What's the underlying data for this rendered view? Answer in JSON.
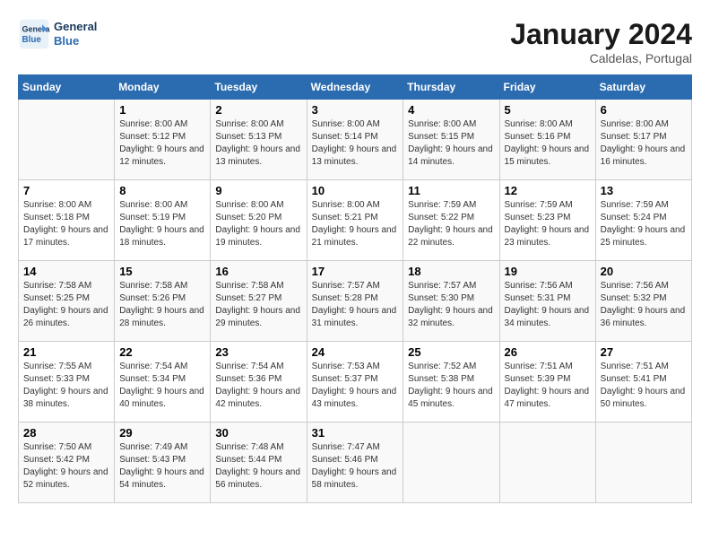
{
  "header": {
    "logo_line1": "General",
    "logo_line2": "Blue",
    "title": "January 2024",
    "subtitle": "Caldelas, Portugal"
  },
  "columns": [
    "Sunday",
    "Monday",
    "Tuesday",
    "Wednesday",
    "Thursday",
    "Friday",
    "Saturday"
  ],
  "weeks": [
    [
      {
        "day": "",
        "sunrise": "",
        "sunset": "",
        "daylight": ""
      },
      {
        "day": "1",
        "sunrise": "Sunrise: 8:00 AM",
        "sunset": "Sunset: 5:12 PM",
        "daylight": "Daylight: 9 hours and 12 minutes."
      },
      {
        "day": "2",
        "sunrise": "Sunrise: 8:00 AM",
        "sunset": "Sunset: 5:13 PM",
        "daylight": "Daylight: 9 hours and 13 minutes."
      },
      {
        "day": "3",
        "sunrise": "Sunrise: 8:00 AM",
        "sunset": "Sunset: 5:14 PM",
        "daylight": "Daylight: 9 hours and 13 minutes."
      },
      {
        "day": "4",
        "sunrise": "Sunrise: 8:00 AM",
        "sunset": "Sunset: 5:15 PM",
        "daylight": "Daylight: 9 hours and 14 minutes."
      },
      {
        "day": "5",
        "sunrise": "Sunrise: 8:00 AM",
        "sunset": "Sunset: 5:16 PM",
        "daylight": "Daylight: 9 hours and 15 minutes."
      },
      {
        "day": "6",
        "sunrise": "Sunrise: 8:00 AM",
        "sunset": "Sunset: 5:17 PM",
        "daylight": "Daylight: 9 hours and 16 minutes."
      }
    ],
    [
      {
        "day": "7",
        "sunrise": "Sunrise: 8:00 AM",
        "sunset": "Sunset: 5:18 PM",
        "daylight": "Daylight: 9 hours and 17 minutes."
      },
      {
        "day": "8",
        "sunrise": "Sunrise: 8:00 AM",
        "sunset": "Sunset: 5:19 PM",
        "daylight": "Daylight: 9 hours and 18 minutes."
      },
      {
        "day": "9",
        "sunrise": "Sunrise: 8:00 AM",
        "sunset": "Sunset: 5:20 PM",
        "daylight": "Daylight: 9 hours and 19 minutes."
      },
      {
        "day": "10",
        "sunrise": "Sunrise: 8:00 AM",
        "sunset": "Sunset: 5:21 PM",
        "daylight": "Daylight: 9 hours and 21 minutes."
      },
      {
        "day": "11",
        "sunrise": "Sunrise: 7:59 AM",
        "sunset": "Sunset: 5:22 PM",
        "daylight": "Daylight: 9 hours and 22 minutes."
      },
      {
        "day": "12",
        "sunrise": "Sunrise: 7:59 AM",
        "sunset": "Sunset: 5:23 PM",
        "daylight": "Daylight: 9 hours and 23 minutes."
      },
      {
        "day": "13",
        "sunrise": "Sunrise: 7:59 AM",
        "sunset": "Sunset: 5:24 PM",
        "daylight": "Daylight: 9 hours and 25 minutes."
      }
    ],
    [
      {
        "day": "14",
        "sunrise": "Sunrise: 7:58 AM",
        "sunset": "Sunset: 5:25 PM",
        "daylight": "Daylight: 9 hours and 26 minutes."
      },
      {
        "day": "15",
        "sunrise": "Sunrise: 7:58 AM",
        "sunset": "Sunset: 5:26 PM",
        "daylight": "Daylight: 9 hours and 28 minutes."
      },
      {
        "day": "16",
        "sunrise": "Sunrise: 7:58 AM",
        "sunset": "Sunset: 5:27 PM",
        "daylight": "Daylight: 9 hours and 29 minutes."
      },
      {
        "day": "17",
        "sunrise": "Sunrise: 7:57 AM",
        "sunset": "Sunset: 5:28 PM",
        "daylight": "Daylight: 9 hours and 31 minutes."
      },
      {
        "day": "18",
        "sunrise": "Sunrise: 7:57 AM",
        "sunset": "Sunset: 5:30 PM",
        "daylight": "Daylight: 9 hours and 32 minutes."
      },
      {
        "day": "19",
        "sunrise": "Sunrise: 7:56 AM",
        "sunset": "Sunset: 5:31 PM",
        "daylight": "Daylight: 9 hours and 34 minutes."
      },
      {
        "day": "20",
        "sunrise": "Sunrise: 7:56 AM",
        "sunset": "Sunset: 5:32 PM",
        "daylight": "Daylight: 9 hours and 36 minutes."
      }
    ],
    [
      {
        "day": "21",
        "sunrise": "Sunrise: 7:55 AM",
        "sunset": "Sunset: 5:33 PM",
        "daylight": "Daylight: 9 hours and 38 minutes."
      },
      {
        "day": "22",
        "sunrise": "Sunrise: 7:54 AM",
        "sunset": "Sunset: 5:34 PM",
        "daylight": "Daylight: 9 hours and 40 minutes."
      },
      {
        "day": "23",
        "sunrise": "Sunrise: 7:54 AM",
        "sunset": "Sunset: 5:36 PM",
        "daylight": "Daylight: 9 hours and 42 minutes."
      },
      {
        "day": "24",
        "sunrise": "Sunrise: 7:53 AM",
        "sunset": "Sunset: 5:37 PM",
        "daylight": "Daylight: 9 hours and 43 minutes."
      },
      {
        "day": "25",
        "sunrise": "Sunrise: 7:52 AM",
        "sunset": "Sunset: 5:38 PM",
        "daylight": "Daylight: 9 hours and 45 minutes."
      },
      {
        "day": "26",
        "sunrise": "Sunrise: 7:51 AM",
        "sunset": "Sunset: 5:39 PM",
        "daylight": "Daylight: 9 hours and 47 minutes."
      },
      {
        "day": "27",
        "sunrise": "Sunrise: 7:51 AM",
        "sunset": "Sunset: 5:41 PM",
        "daylight": "Daylight: 9 hours and 50 minutes."
      }
    ],
    [
      {
        "day": "28",
        "sunrise": "Sunrise: 7:50 AM",
        "sunset": "Sunset: 5:42 PM",
        "daylight": "Daylight: 9 hours and 52 minutes."
      },
      {
        "day": "29",
        "sunrise": "Sunrise: 7:49 AM",
        "sunset": "Sunset: 5:43 PM",
        "daylight": "Daylight: 9 hours and 54 minutes."
      },
      {
        "day": "30",
        "sunrise": "Sunrise: 7:48 AM",
        "sunset": "Sunset: 5:44 PM",
        "daylight": "Daylight: 9 hours and 56 minutes."
      },
      {
        "day": "31",
        "sunrise": "Sunrise: 7:47 AM",
        "sunset": "Sunset: 5:46 PM",
        "daylight": "Daylight: 9 hours and 58 minutes."
      },
      {
        "day": "",
        "sunrise": "",
        "sunset": "",
        "daylight": ""
      },
      {
        "day": "",
        "sunrise": "",
        "sunset": "",
        "daylight": ""
      },
      {
        "day": "",
        "sunrise": "",
        "sunset": "",
        "daylight": ""
      }
    ]
  ]
}
